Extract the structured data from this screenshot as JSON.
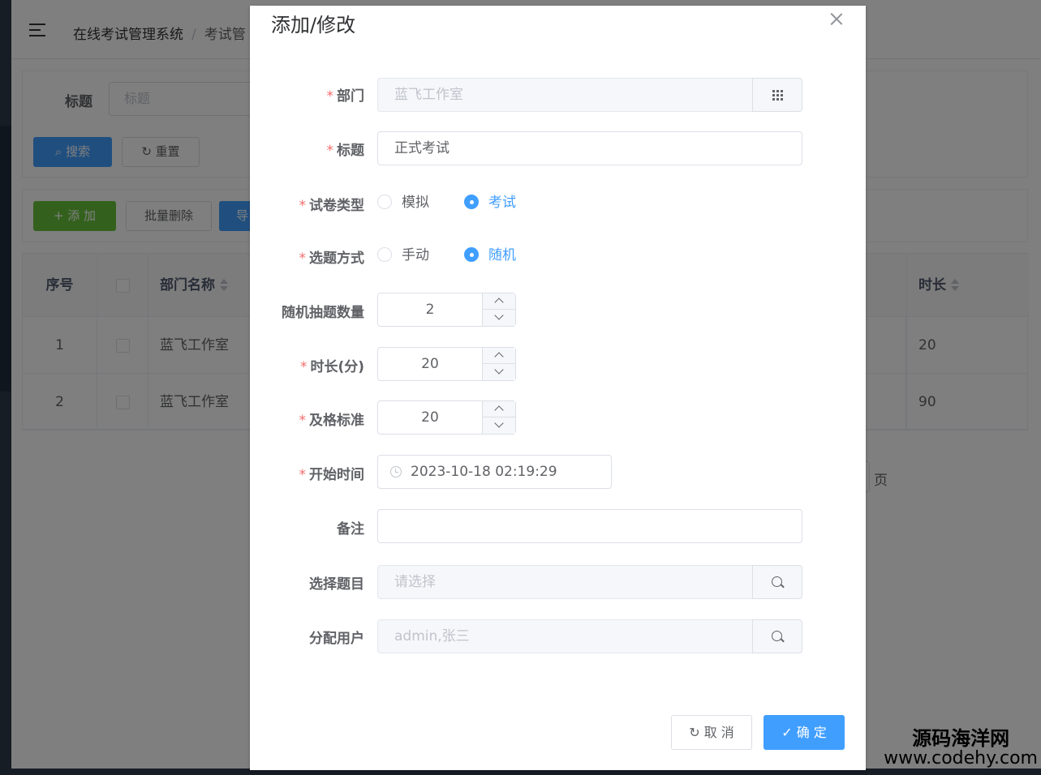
{
  "header": {
    "breadcrumb": [
      "在线考试管理系统",
      "/",
      "考试管"
    ]
  },
  "search": {
    "title_label": "标题",
    "title_placeholder": "标题",
    "search_label": "搜索",
    "reset_label": "重置"
  },
  "toolbar": {
    "add_label": "+ 添 加",
    "batch_delete_label": "批量删除",
    "export_label": "导"
  },
  "table": {
    "columns": [
      "序号",
      "部门名称",
      "时长"
    ],
    "rows": [
      {
        "index": "1",
        "dept": "蓝飞工作室",
        "duration": "20"
      },
      {
        "index": "2",
        "dept": "蓝飞工作室",
        "duration": "90"
      }
    ]
  },
  "pagination": {
    "unit": "页"
  },
  "dialog": {
    "title": "添加/修改",
    "fields": {
      "dept": {
        "label": "部门",
        "value": "蓝飞工作室"
      },
      "title": {
        "label": "标题",
        "value": "正式考试"
      },
      "paper_type": {
        "label": "试卷类型",
        "options": [
          "模拟",
          "考试"
        ],
        "selected": "考试"
      },
      "select_mode": {
        "label": "选题方式",
        "options": [
          "手动",
          "随机"
        ],
        "selected": "随机"
      },
      "random_count": {
        "label": "随机抽题数量",
        "value": "2"
      },
      "duration": {
        "label": "时长(分)",
        "value": "20"
      },
      "pass_score": {
        "label": "及格标准",
        "value": "20"
      },
      "start_time": {
        "label": "开始时间",
        "value": "2023-10-18 02:19:29"
      },
      "remark": {
        "label": "备注",
        "value": ""
      },
      "questions": {
        "label": "选择题目",
        "placeholder": "请选择"
      },
      "users": {
        "label": "分配用户",
        "value": "admin,张三"
      }
    },
    "required_mark": "*",
    "cancel_label": "取 消",
    "ok_label": "确 定"
  },
  "watermark": {
    "name": "源码海洋网",
    "url": "www.codehy.com"
  },
  "colors": {
    "primary": "#409eff",
    "success": "#67c23a",
    "danger": "#f56c6c",
    "overlay": "rgba(0,0,0,0.5)"
  }
}
